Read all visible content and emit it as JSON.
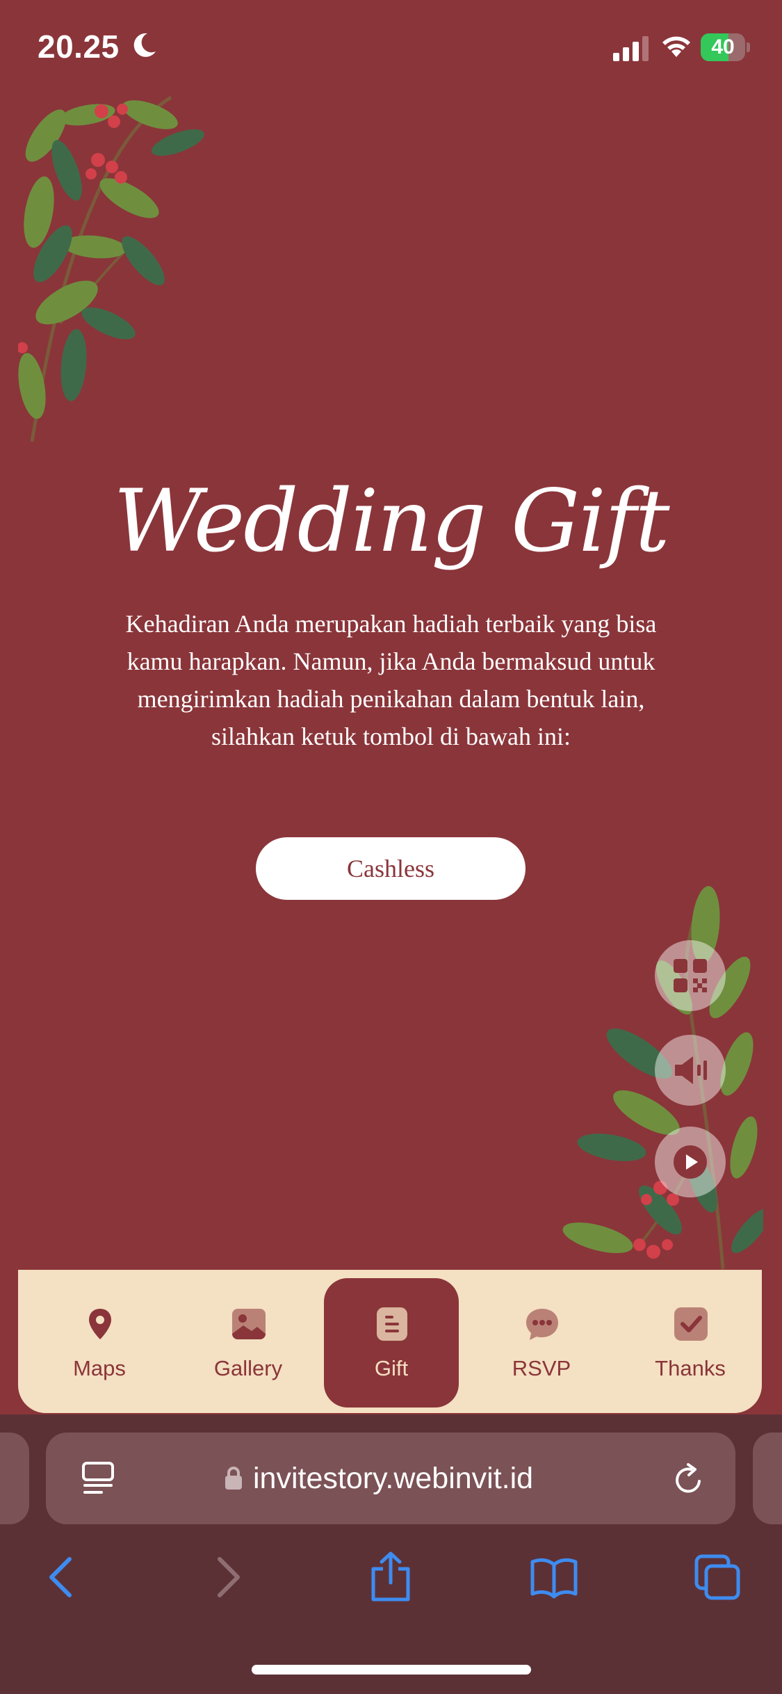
{
  "status_bar": {
    "time": "20.25",
    "battery_level": "40"
  },
  "gift": {
    "title": "Wedding Gift",
    "description": "Kehadiran Anda merupakan hadiah terbaik yang bisa kamu harapkan. Namun, jika Anda bermaksud untuk mengirimkan hadiah penikahan dalam bentuk lain, silahkan ketuk tombol di bawah ini:",
    "button_label": "Cashless"
  },
  "floating_buttons": [
    "qr-code-icon",
    "speaker-icon",
    "play-icon"
  ],
  "nav": {
    "active": "Gift",
    "items": [
      {
        "label": "Maps",
        "icon": "map-pin-icon"
      },
      {
        "label": "Gallery",
        "icon": "image-icon"
      },
      {
        "label": "Gift",
        "icon": "document-icon"
      },
      {
        "label": "RSVP",
        "icon": "chat-bubble-icon"
      },
      {
        "label": "Thanks",
        "icon": "checkbox-icon"
      }
    ]
  },
  "browser": {
    "url": "invitestory.webinvit.id",
    "toolbar": [
      "back-icon",
      "forward-icon",
      "share-icon",
      "bookmarks-icon",
      "tabs-icon"
    ]
  },
  "colors": {
    "background": "#8a353a",
    "nav_background": "#f4e0c2",
    "browser_chrome": "#5c3136",
    "accent_blue": "#3e8cf0",
    "battery_green": "#34c759"
  }
}
